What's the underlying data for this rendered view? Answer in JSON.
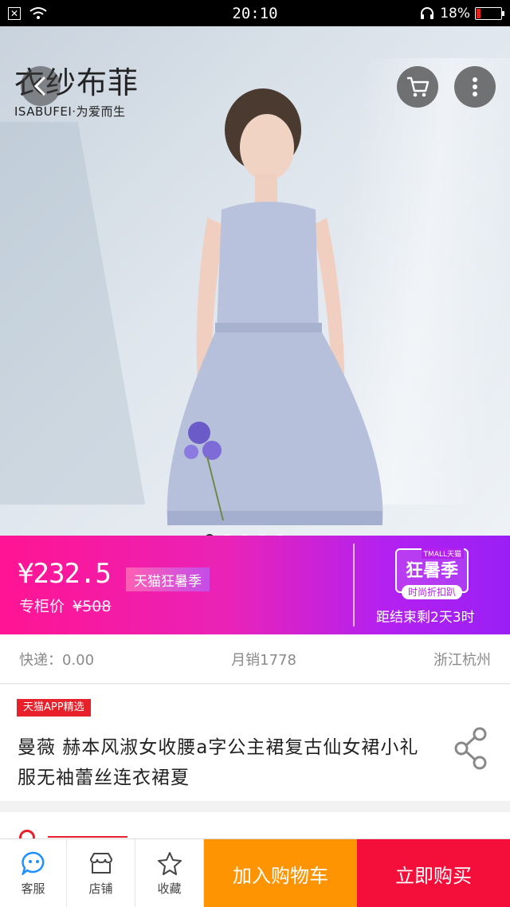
{
  "status_bar": {
    "time": "20:10",
    "battery": "18%",
    "battery_fill": 0.18
  },
  "brand": {
    "name_cn": "衣纱布菲",
    "name_en": "ISABUFEI·为爱而生"
  },
  "gallery": {
    "slide_count": 5,
    "active_index": 0
  },
  "price_banner": {
    "price": "¥232.5",
    "promo_tag": "天猫狂暑季",
    "orig_label": "专柜价",
    "orig_price": "¥508",
    "season_small": "TMALL天猫",
    "season_title": "狂暑季",
    "season_sub": "时尚折扣趴",
    "countdown": "距结束剩2天3时"
  },
  "shipping": {
    "express": "快递：0.00",
    "monthly_sales": "月销1778",
    "location": "浙江杭州"
  },
  "product": {
    "app_tag": "天猫APP精选",
    "title": "曼薇 赫本风淑女收腰a字公主裙复古仙女裙小礼服无袖蕾丝连衣裙夏"
  },
  "bottom_bar": {
    "service": "客服",
    "shop": "店铺",
    "favorite": "收藏",
    "add_cart": "加入购物车",
    "buy_now": "立即购买"
  },
  "colors": {
    "banner_start": "#ff1493",
    "banner_end": "#9a1ff5",
    "cart_btn": "#ff9402",
    "buy_btn": "#f40f3b",
    "tag_red": "#e8202a"
  }
}
